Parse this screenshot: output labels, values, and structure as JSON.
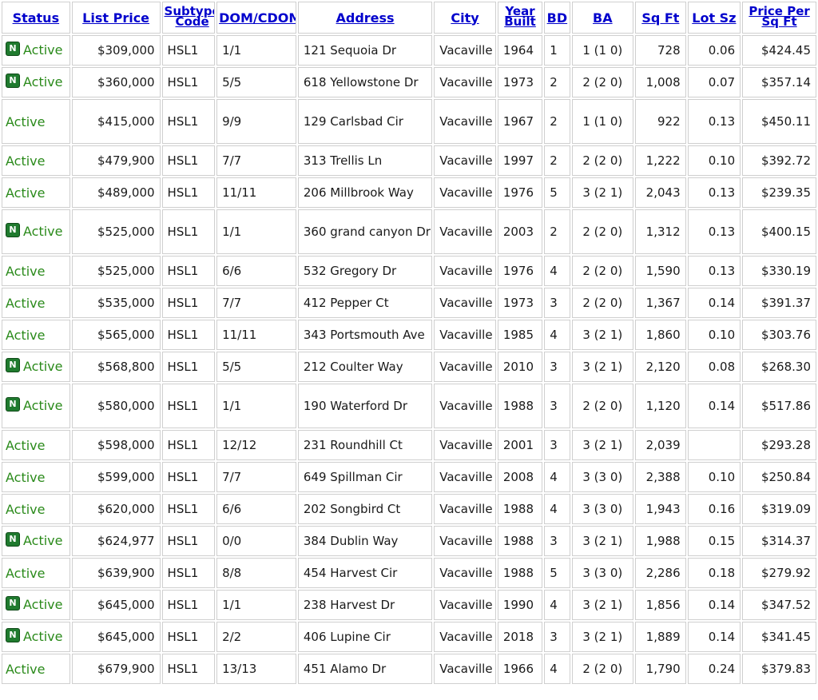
{
  "columns": [
    "Status",
    "List Price",
    "Subtype Code",
    "DOM/CDOM",
    "Address",
    "City",
    "Year Built",
    "BD",
    "BA",
    "Sq Ft",
    "Lot Sz",
    "Price Per Sq Ft"
  ],
  "column_lines": {
    "subtype": [
      "Subtype",
      "Code"
    ],
    "year": [
      "Year",
      "Built"
    ],
    "ppsf": [
      "Price Per",
      "Sq Ft"
    ]
  },
  "badge_label": "N",
  "rows": [
    {
      "new": true,
      "status": "Active",
      "price": "$309,000",
      "subtype": "HSL1",
      "dom": "1/1",
      "address": "121 Sequoia Dr",
      "city": "Vacaville",
      "year": "1964",
      "bd": "1",
      "ba": "1 (1 0)",
      "sqft": "728",
      "lot": "0.06",
      "ppsf": "$424.45"
    },
    {
      "new": true,
      "status": "Active",
      "price": "$360,000",
      "subtype": "HSL1",
      "dom": "5/5",
      "address": "618 Yellowstone Dr",
      "city": "Vacaville",
      "year": "1973",
      "bd": "2",
      "ba": "2 (2 0)",
      "sqft": "1,008",
      "lot": "0.07",
      "ppsf": "$357.14"
    },
    {
      "new": false,
      "status": "Active",
      "price": "$415,000",
      "subtype": "HSL1",
      "dom": "9/9",
      "address": "129 Carlsbad Cir",
      "city": "Vacaville",
      "year": "1967",
      "bd": "2",
      "ba": "1 (1 0)",
      "sqft": "922",
      "lot": "0.13",
      "ppsf": "$450.11"
    },
    {
      "new": false,
      "status": "Active",
      "price": "$479,900",
      "subtype": "HSL1",
      "dom": "7/7",
      "address": "313 Trellis Ln",
      "city": "Vacaville",
      "year": "1997",
      "bd": "2",
      "ba": "2 (2 0)",
      "sqft": "1,222",
      "lot": "0.10",
      "ppsf": "$392.72"
    },
    {
      "new": false,
      "status": "Active",
      "price": "$489,000",
      "subtype": "HSL1",
      "dom": "11/11",
      "address": "206 Millbrook Way",
      "city": "Vacaville",
      "year": "1976",
      "bd": "5",
      "ba": "3 (2 1)",
      "sqft": "2,043",
      "lot": "0.13",
      "ppsf": "$239.35"
    },
    {
      "new": true,
      "status": "Active",
      "price": "$525,000",
      "subtype": "HSL1",
      "dom": "1/1",
      "address": "360 grand canyon Dr",
      "city": "Vacaville",
      "year": "2003",
      "bd": "2",
      "ba": "2 (2 0)",
      "sqft": "1,312",
      "lot": "0.13",
      "ppsf": "$400.15"
    },
    {
      "new": false,
      "status": "Active",
      "price": "$525,000",
      "subtype": "HSL1",
      "dom": "6/6",
      "address": "532 Gregory Dr",
      "city": "Vacaville",
      "year": "1976",
      "bd": "4",
      "ba": "2 (2 0)",
      "sqft": "1,590",
      "lot": "0.13",
      "ppsf": "$330.19"
    },
    {
      "new": false,
      "status": "Active",
      "price": "$535,000",
      "subtype": "HSL1",
      "dom": "7/7",
      "address": "412 Pepper Ct",
      "city": "Vacaville",
      "year": "1973",
      "bd": "3",
      "ba": "2 (2 0)",
      "sqft": "1,367",
      "lot": "0.14",
      "ppsf": "$391.37"
    },
    {
      "new": false,
      "status": "Active",
      "price": "$565,000",
      "subtype": "HSL1",
      "dom": "11/11",
      "address": "343 Portsmouth Ave",
      "city": "Vacaville",
      "year": "1985",
      "bd": "4",
      "ba": "3 (2 1)",
      "sqft": "1,860",
      "lot": "0.10",
      "ppsf": "$303.76"
    },
    {
      "new": true,
      "status": "Active",
      "price": "$568,800",
      "subtype": "HSL1",
      "dom": "5/5",
      "address": "212 Coulter Way",
      "city": "Vacaville",
      "year": "2010",
      "bd": "3",
      "ba": "3 (2 1)",
      "sqft": "2,120",
      "lot": "0.08",
      "ppsf": "$268.30"
    },
    {
      "new": true,
      "status": "Active",
      "price": "$580,000",
      "subtype": "HSL1",
      "dom": "1/1",
      "address": "190 Waterford Dr",
      "city": "Vacaville",
      "year": "1988",
      "bd": "3",
      "ba": "2 (2 0)",
      "sqft": "1,120",
      "lot": "0.14",
      "ppsf": "$517.86"
    },
    {
      "new": false,
      "status": "Active",
      "price": "$598,000",
      "subtype": "HSL1",
      "dom": "12/12",
      "address": "231 Roundhill Ct",
      "city": "Vacaville",
      "year": "2001",
      "bd": "3",
      "ba": "3 (2 1)",
      "sqft": "2,039",
      "lot": "",
      "ppsf": "$293.28"
    },
    {
      "new": false,
      "status": "Active",
      "price": "$599,000",
      "subtype": "HSL1",
      "dom": "7/7",
      "address": "649 Spillman Cir",
      "city": "Vacaville",
      "year": "2008",
      "bd": "4",
      "ba": "3 (3 0)",
      "sqft": "2,388",
      "lot": "0.10",
      "ppsf": "$250.84"
    },
    {
      "new": false,
      "status": "Active",
      "price": "$620,000",
      "subtype": "HSL1",
      "dom": "6/6",
      "address": "202 Songbird Ct",
      "city": "Vacaville",
      "year": "1988",
      "bd": "4",
      "ba": "3 (3 0)",
      "sqft": "1,943",
      "lot": "0.16",
      "ppsf": "$319.09"
    },
    {
      "new": true,
      "status": "Active",
      "price": "$624,977",
      "subtype": "HSL1",
      "dom": "0/0",
      "address": "384 Dublin Way",
      "city": "Vacaville",
      "year": "1988",
      "bd": "3",
      "ba": "3 (2 1)",
      "sqft": "1,988",
      "lot": "0.15",
      "ppsf": "$314.37"
    },
    {
      "new": false,
      "status": "Active",
      "price": "$639,900",
      "subtype": "HSL1",
      "dom": "8/8",
      "address": "454 Harvest Cir",
      "city": "Vacaville",
      "year": "1988",
      "bd": "5",
      "ba": "3 (3 0)",
      "sqft": "2,286",
      "lot": "0.18",
      "ppsf": "$279.92"
    },
    {
      "new": true,
      "status": "Active",
      "price": "$645,000",
      "subtype": "HSL1",
      "dom": "1/1",
      "address": "238 Harvest Dr",
      "city": "Vacaville",
      "year": "1990",
      "bd": "4",
      "ba": "3 (2 1)",
      "sqft": "1,856",
      "lot": "0.14",
      "ppsf": "$347.52"
    },
    {
      "new": true,
      "status": "Active",
      "price": "$645,000",
      "subtype": "HSL1",
      "dom": "2/2",
      "address": "406 Lupine Cir",
      "city": "Vacaville",
      "year": "2018",
      "bd": "3",
      "ba": "3 (2 1)",
      "sqft": "1,889",
      "lot": "0.14",
      "ppsf": "$341.45"
    },
    {
      "new": false,
      "status": "Active",
      "price": "$679,900",
      "subtype": "HSL1",
      "dom": "13/13",
      "address": "451 Alamo Dr",
      "city": "Vacaville",
      "year": "1966",
      "bd": "4",
      "ba": "2 (2 0)",
      "sqft": "1,790",
      "lot": "0.24",
      "ppsf": "$379.83"
    }
  ],
  "colors": {
    "status_text": "#2a8a1a",
    "badge_bg": "#1f7a2e",
    "header_link": "#0000cc",
    "grid_line": "#cfcfcf"
  }
}
